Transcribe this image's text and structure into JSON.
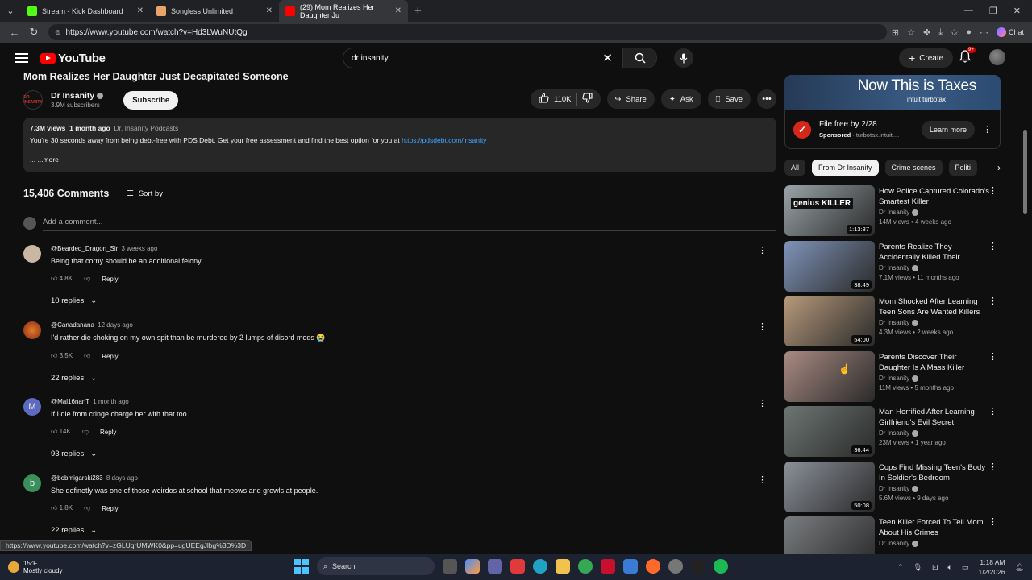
{
  "browser": {
    "tabs": [
      {
        "label": "Stream - Kick Dashboard",
        "color": "#53fc18"
      },
      {
        "label": "Songless Unlimited",
        "color": "#e9a46b"
      },
      {
        "label": "(29) Mom Realizes Her Daughter Ju",
        "color": "#ff0000"
      }
    ],
    "url": "https://www.youtube.com/watch?v=Hd3LWuNUtQg",
    "chat_label": "Chat"
  },
  "header": {
    "logo_text": "YouTube",
    "search_value": "dr insanity",
    "create_label": "Create",
    "notif_badge": "9+"
  },
  "video": {
    "title": "Mom Realizes Her Daughter Just Decapitated Someone",
    "channel": "Dr Insanity",
    "channel_logo_text": "DR INSANITY",
    "subscribers": "3.9M subscribers",
    "subscribe_label": "Subscribe",
    "likes": "110K",
    "share_label": "Share",
    "ask_label": "Ask",
    "save_label": "Save"
  },
  "description": {
    "views": "7.3M views",
    "age": "1 month ago",
    "tag": "Dr. Insanity Podcasts",
    "text": "You're 30 seconds away from being debt-free with PDS Debt. Get your free assessment and find the best option for you at",
    "link": "https://pdsdebt.com/insanity",
    "more": "... ...more"
  },
  "comments": {
    "count": "15,406 Comments",
    "sort_label": "Sort by",
    "add_placeholder": "Add a comment...",
    "reply_label": "Reply",
    "items": [
      {
        "author": "@Bearded_Dragon_Sir",
        "time": "3 weeks ago",
        "text": "Being that corny should be an additional felony",
        "likes": "4.8K",
        "replies": "10 replies",
        "avatar_color": "#c9b7a4"
      },
      {
        "author": "@Canadanana",
        "time": "12 days ago",
        "text": "I'd rather die choking on my own spit than be murdered by 2 lumps of disord mods 😭",
        "likes": "3.5K",
        "replies": "22 replies",
        "avatar_color": "#c8542a"
      },
      {
        "author": "@Mal16nanT",
        "time": "1 month ago",
        "text": "If I die from cringe charge her with that too",
        "likes": "14K",
        "replies": "93 replies",
        "avatar_color": "#5c6bc0",
        "avatar_letter": "M"
      },
      {
        "author": "@bobmigarski283",
        "time": "8 days ago",
        "text": "She definetly was one of those weirdos at school that meows and growls at people.",
        "likes": "1.8K",
        "replies": "22 replies",
        "avatar_color": "#3a8f5c",
        "avatar_letter": "b"
      }
    ]
  },
  "ad": {
    "headline": "Now This is Taxes",
    "brand": "intuit turbotax",
    "title": "File free by 2/28",
    "sponsored": "Sponsored",
    "domain": "turbotax.intuit....",
    "cta": "Learn more"
  },
  "chips": [
    "All",
    "From Dr Insanity",
    "Crime scenes",
    "Politi"
  ],
  "recommendations": [
    {
      "title": "How Police Captured Colorado's Smartest Killer",
      "channel": "Dr Insanity",
      "meta": "14M views • 4 weeks ago",
      "duration": "1:13:37",
      "thumb": "#9aa4a8",
      "thumb_text": "genius KILLER"
    },
    {
      "title": "Parents Realize They Accidentally Killed Their ...",
      "channel": "Dr Insanity",
      "meta": "7.1M views • 11 months ago",
      "duration": "38:49",
      "thumb": "#7f93b8"
    },
    {
      "title": "Mom Shocked After Learning Teen Sons Are Wanted Killers",
      "channel": "Dr Insanity",
      "meta": "4.3M views • 2 weeks ago",
      "duration": "54:00",
      "thumb": "#b79a7c"
    },
    {
      "title": "Parents Discover Their Daughter Is A Mass Killer",
      "channel": "Dr Insanity",
      "meta": "11M views • 5 months ago",
      "duration": "",
      "thumb": "#a98a82"
    },
    {
      "title": "Man Horrified After Learning Girlfriend's Evil Secret",
      "channel": "Dr Insanity",
      "meta": "23M views • 1 year ago",
      "duration": "36:44",
      "thumb": "#6d7672"
    },
    {
      "title": "Cops Find Missing Teen's Body In Soldier's Bedroom",
      "channel": "Dr Insanity",
      "meta": "5.6M views • 9 days ago",
      "duration": "50:08",
      "thumb": "#8b9099"
    },
    {
      "title": "Teen Killer Forced To Tell Mom About His Crimes",
      "channel": "Dr Insanity",
      "meta": "",
      "duration": "",
      "thumb": "#7a7d80"
    }
  ],
  "status_url": "https://www.youtube.com/watch?v=zGLUqrUMWK0&pp=ugUEEgJlbg%3D%3D",
  "taskbar": {
    "temp": "15°F",
    "weather": "Mostly cloudy",
    "search_label": "Search",
    "time": "1:18 AM",
    "date": "1/2/2026"
  }
}
